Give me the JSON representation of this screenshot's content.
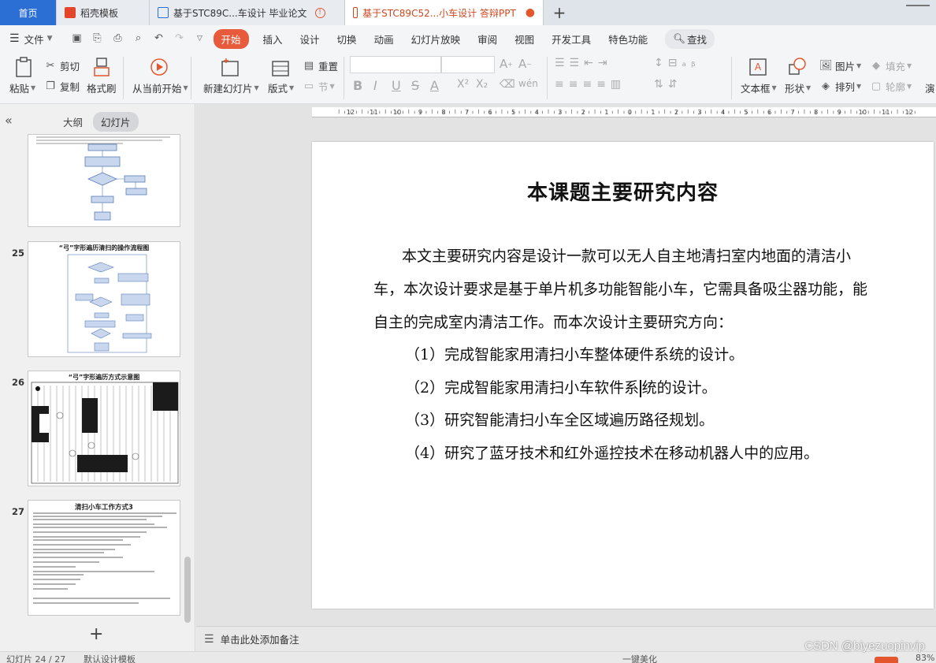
{
  "tabs": [
    {
      "label": "首页",
      "icon": "home-tab"
    },
    {
      "label": "稻壳模板",
      "icon": "docer-icon"
    },
    {
      "label": "基于STC89C...车设计 毕业论文",
      "icon": "word-doc-icon"
    },
    {
      "label": "基于STC89C52...小车设计 答辩PPT",
      "icon": "ppt-doc-icon"
    }
  ],
  "tab_add": "+",
  "menu": {
    "file": "文件",
    "items": [
      "开始",
      "插入",
      "设计",
      "切换",
      "动画",
      "幻灯片放映",
      "审阅",
      "视图",
      "开发工具",
      "特色功能"
    ],
    "search": "查找"
  },
  "ribbon": {
    "paste": "粘贴",
    "cut": "剪切",
    "copy": "复制",
    "format_painter": "格式刷",
    "from_current": "从当前开始",
    "new_slide": "新建幻灯片",
    "layout": "版式",
    "reset": "重置",
    "section": "节",
    "textbox": "文本框",
    "shape": "形状",
    "picture": "图片",
    "arrange": "排列",
    "fill": "填充",
    "outline": "轮廓",
    "more": "演"
  },
  "left_panel": {
    "outline_tab": "大纲",
    "slides_tab": "幻灯片",
    "thumbs": [
      {
        "num": "",
        "title": ""
      },
      {
        "num": "25",
        "title": "“弓”字形遍历清扫的操作流程图"
      },
      {
        "num": "26",
        "title": "“弓”字形遍历方式示意图"
      },
      {
        "num": "27",
        "title": "清扫小车工作方式3"
      }
    ],
    "add": "+"
  },
  "slide": {
    "title": "本课题主要研究内容",
    "paragraph": "本文主要研究内容是设计一款可以无人自主地清扫室内地面的清洁小车，本次设计要求是基于单片机多功能智能小车，它需具备吸尘器功能，能自主的完成室内清洁工作。而本次设计主要研究方向：",
    "items": [
      "（1）完成智能家用清扫小车整体硬件系统的设计。",
      "（2）完成智能家用清扫小车软件系统的设计。",
      "（3）研究智能清扫小车全区域遍历路径规划。",
      "（4）研究了蓝牙技术和红外遥控技术在移动机器人中的应用。"
    ]
  },
  "notes_placeholder": "单击此处添加备注",
  "statusbar": {
    "slide_info": "幻灯片 24 / 27",
    "theme": "默认设计模板",
    "beautify": "一键美化",
    "zoom": "83%"
  },
  "watermark": "CSDN @biyezuopinvip",
  "ruler_labels": [
    "12",
    "11",
    "10",
    "9",
    "8",
    "7",
    "6",
    "5",
    "4",
    "3",
    "2",
    "1",
    "0",
    "1",
    "2",
    "3",
    "4",
    "5",
    "6",
    "7",
    "8",
    "9",
    "10",
    "11",
    "12"
  ],
  "colors": {
    "accent": "#e75a3c",
    "home_tab": "#2b6ed4"
  }
}
